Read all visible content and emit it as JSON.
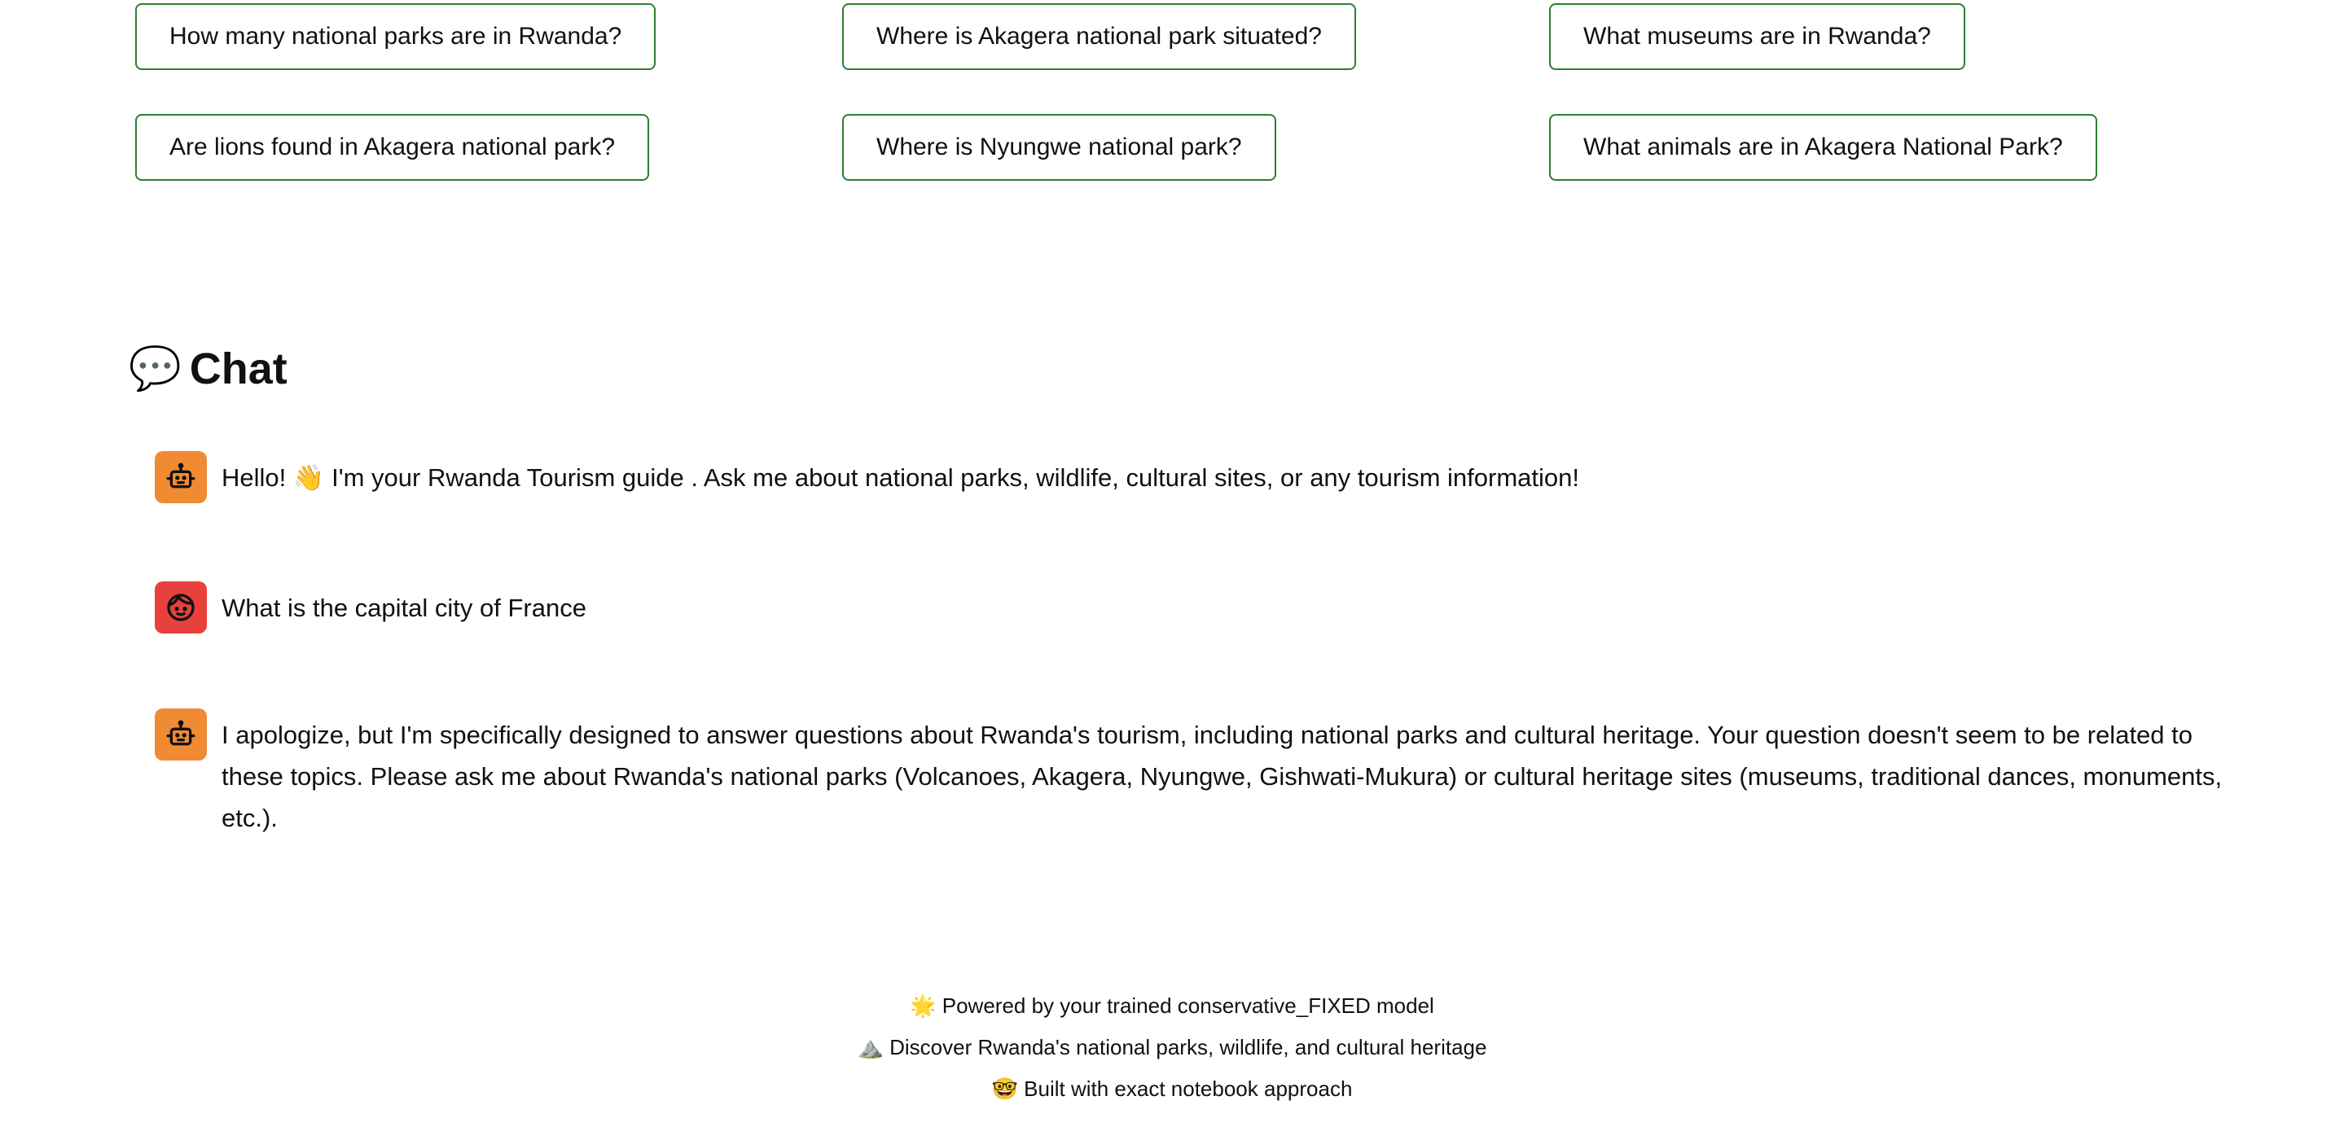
{
  "suggestions": [
    {
      "label": "How many national parks are in Rwanda?"
    },
    {
      "label": "Where is Akagera national park situated?"
    },
    {
      "label": "What museums are in Rwanda?"
    },
    {
      "label": "Are lions found in Akagera national park?"
    },
    {
      "label": "Where is Nyungwe national park?"
    },
    {
      "label": "What animals are in Akagera National Park?"
    }
  ],
  "chat": {
    "heading_icon": "💬",
    "heading": "Chat",
    "messages": [
      {
        "role": "assistant",
        "avatar_icon": "robot-icon",
        "text": "Hello! 👋 I'm your Rwanda Tourism guide . Ask me about national parks, wildlife, cultural sites, or any tourism information!"
      },
      {
        "role": "user",
        "avatar_icon": "face-icon",
        "text": "What is the capital city of France"
      },
      {
        "role": "assistant",
        "avatar_icon": "robot-icon",
        "text": "I apologize, but I'm specifically designed to answer questions about Rwanda's tourism, including national parks and cultural heritage. Your question doesn't seem to be related to these topics. Please ask me about Rwanda's national parks (Volcanoes, Akagera, Nyungwe, Gishwati-Mukura) or cultural heritage sites (museums, traditional dances, monuments, etc.)."
      }
    ]
  },
  "footer": {
    "line1": "🌟 Powered by your trained conservative_FIXED model",
    "line2": "⛰️ Discover Rwanda's national parks, wildlife, and cultural heritage",
    "line3": "🤓 Built with exact notebook approach"
  },
  "colors": {
    "button_border": "#2e7d32",
    "bot_avatar": "#f08a33",
    "user_avatar": "#e8403a",
    "text": "#111111"
  }
}
